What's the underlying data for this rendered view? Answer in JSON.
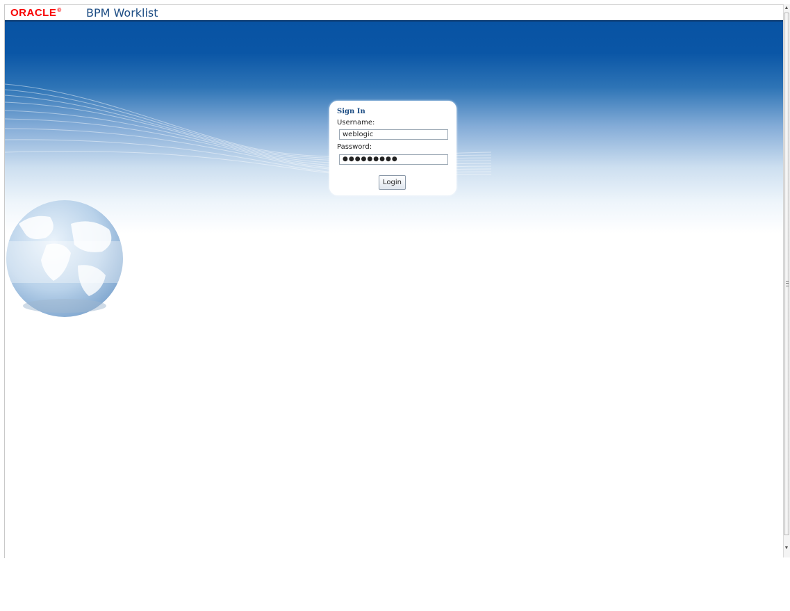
{
  "header": {
    "logo_text": "ORACLE",
    "logo_mark": "®",
    "app_title": "BPM Worklist"
  },
  "signin": {
    "title": "Sign In",
    "username_label": "Username:",
    "username_value": "weblogic",
    "password_label": "Password:",
    "password_masked": "●●●●●●●●●",
    "login_label": "Login"
  },
  "scrollbar": {
    "up_icon": "▲",
    "down_icon": "▼"
  },
  "colors": {
    "oracle_red": "#f80000",
    "title_blue": "#1c4c83",
    "banner_dark_blue": "#0853a3"
  }
}
